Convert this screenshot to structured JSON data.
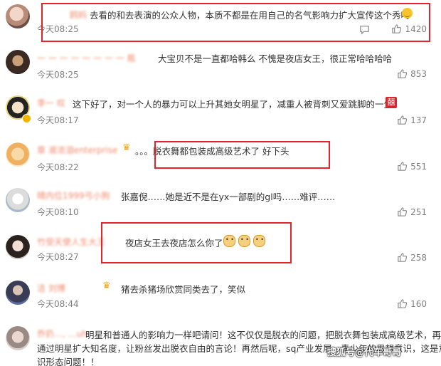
{
  "comments": [
    {
      "name": "鸥妈",
      "text": "去看的和去表演的公众人物，本质不都是在用自己的名气影响力扩大宣传这个秀吗",
      "time": "今天08:25",
      "likes": "1420"
    },
    {
      "name": "一 一 一 一 一 一 一 一 瓶",
      "text": "大宝贝不是一直都哈韩么 不愧是夜店女王，很正常哈哈哈哈",
      "time": "今天08:25",
      "likes": "853"
    },
    {
      "name": "李一 叹",
      "text": "这下好了，对一个人的暴力可以上升其她女明星了，减重人被背刺又爱跳脚的一生",
      "time": "今天08:17",
      "likes": "137"
    },
    {
      "name": "章 淑浓泪enterprise",
      "text": "。。。脱衣舞都包装成高级艺术了 好下头",
      "time": "今天08:22",
      "likes": "551"
    },
    {
      "name": "晴内位1999弓小狗",
      "text": "张嘉倪……她是近不是在yx一部剧的gl吗……难评……",
      "time": "今天08:10",
      "likes": "251"
    },
    {
      "name": "竹受天使人生大王",
      "text": "夜店女王去夜店怎么你了",
      "time": "今天08:27",
      "likes": "258"
    },
    {
      "name": "洁            刘博",
      "text": "猪去杀猪场欣赏同类去了，笑似",
      "time": "今天08:44",
      "likes": "160"
    },
    {
      "name": "乔扔…, …uh",
      "text_line1": "明星和普通人的影响力一样吧请问！这不仅仅是脱衣的问题，把脱衣舞包装成高级艺术，再",
      "text_line2": "通过明星扩大知名度，让粉丝发出脱衣自由的言论！再然后呢，sq产业发展，青少年的思想意识，这是意",
      "text_line3": "识形态问题！！"
    }
  ],
  "watermark": "搜狐号@代车哥哥",
  "colors": {
    "name": "#eb7350",
    "highlight_box": "#e3242b",
    "vip_badge": "#f2b600"
  },
  "icons": [
    "reply-icon",
    "like-icon",
    "vip-crown-icon",
    "verified-badge-icon"
  ]
}
